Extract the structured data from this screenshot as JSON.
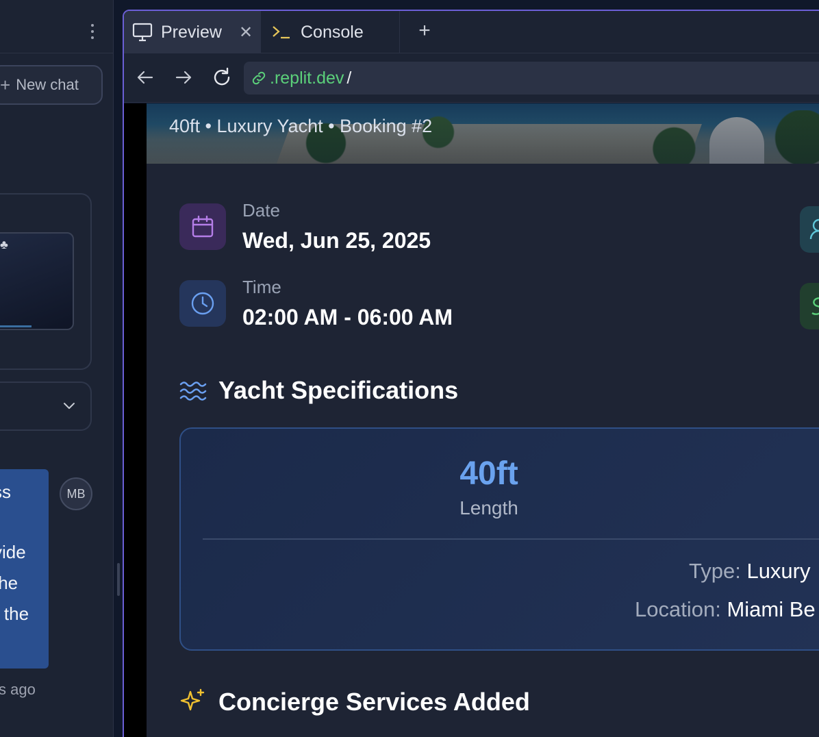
{
  "left_panel": {
    "new_chat_label": "New chat",
    "message_fragments": [
      "ss",
      "vide",
      "the",
      "r the"
    ],
    "avatar_initials": "MB",
    "time_ago": "s ago"
  },
  "tabs": {
    "preview_label": "Preview",
    "console_label": "Console"
  },
  "url": {
    "host": ".replit.dev",
    "path": "/"
  },
  "booking": {
    "subtitle": "40ft • Luxury Yacht • Booking #2",
    "date_label": "Date",
    "date_value": "Wed, Jun 25, 2025",
    "time_label": "Time",
    "time_value": "02:00 AM - 06:00 AM"
  },
  "specs": {
    "title": "Yacht Specifications",
    "length_value": "40ft",
    "length_label": "Length",
    "type_key": "Type:",
    "type_value": "Luxury",
    "location_key": "Location:",
    "location_value": "Miami Be"
  },
  "concierge": {
    "title": "Concierge Services Added"
  },
  "colors": {
    "accent_purple": "#6b5fd6",
    "date_icon": "#b57ee8",
    "time_icon": "#6a9ff0",
    "wave_icon": "#6a9ff0",
    "sparkle_icon": "#f2c230",
    "url_host": "#5bd07a"
  },
  "icons": {
    "kebab": "kebab-menu-icon",
    "new_chat": "plus-icon",
    "chevron": "chevron-down-icon",
    "preview_tab": "monitor-icon",
    "console_tab": "terminal-icon",
    "close": "close-icon",
    "add_tab": "plus-icon",
    "back": "arrow-left-icon",
    "forward": "arrow-right-icon",
    "reload": "reload-icon",
    "link": "link-icon",
    "date": "calendar-icon",
    "time": "clock-icon",
    "guests": "user-icon",
    "price": "dollar-icon",
    "specs": "waves-icon",
    "concierge": "sparkles-icon"
  }
}
